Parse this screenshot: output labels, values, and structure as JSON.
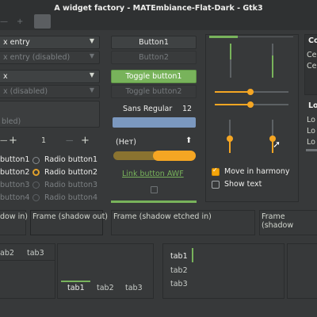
{
  "window": {
    "title": "A widget factory - MATEmbiance-Flat-Dark - Gtk3",
    "controls": [
      "—",
      "+"
    ]
  },
  "left_column": {
    "combo_entry_label": "x entry",
    "combo_entry_disabled_label": "x entry (disabled)",
    "combo_label": "x",
    "combo_disabled_label": "x (disabled)",
    "entry_disabled_label": "bled)",
    "spin_minus": "—",
    "spin_plus": "+",
    "spin_value": "1",
    "spin2_minus": "—",
    "spin2_plus": "+"
  },
  "buttons_column": {
    "button1": "Button1",
    "button2": "Button2",
    "toggle1": "Toggle button1",
    "toggle2": "Toggle button2",
    "font_label": "Sans Regular",
    "font_size": "12",
    "file_label": "(Нет)",
    "link_label": "Link button AWF"
  },
  "checks_radios": {
    "checks": [
      "button1",
      "button2",
      "button3",
      "button4"
    ],
    "radios": [
      "Radio button1",
      "Radio button2",
      "Radio button3",
      "Radio button4"
    ]
  },
  "sliders": {
    "move_label": "Move in harmony",
    "show_label": "Show text"
  },
  "right_partial": {
    "letters": [
      "Co",
      "Ce",
      "Ce",
      "Lo",
      "Lo",
      "Lo",
      "Lo"
    ]
  },
  "frames": {
    "shadow_in": "dow in)",
    "shadow_out": "Frame (shadow out)",
    "shadow_etched_in": "Frame (shadow etched in)",
    "shadow_partial": "Frame (shadow"
  },
  "notebook_top": {
    "tabs": [
      "ab2",
      "tab3"
    ]
  },
  "notebook_bottom": {
    "tabs": [
      "tab1",
      "tab2",
      "tab3"
    ]
  },
  "notebook_left": {
    "tabs": [
      "tab1",
      "tab2",
      "tab3"
    ]
  }
}
